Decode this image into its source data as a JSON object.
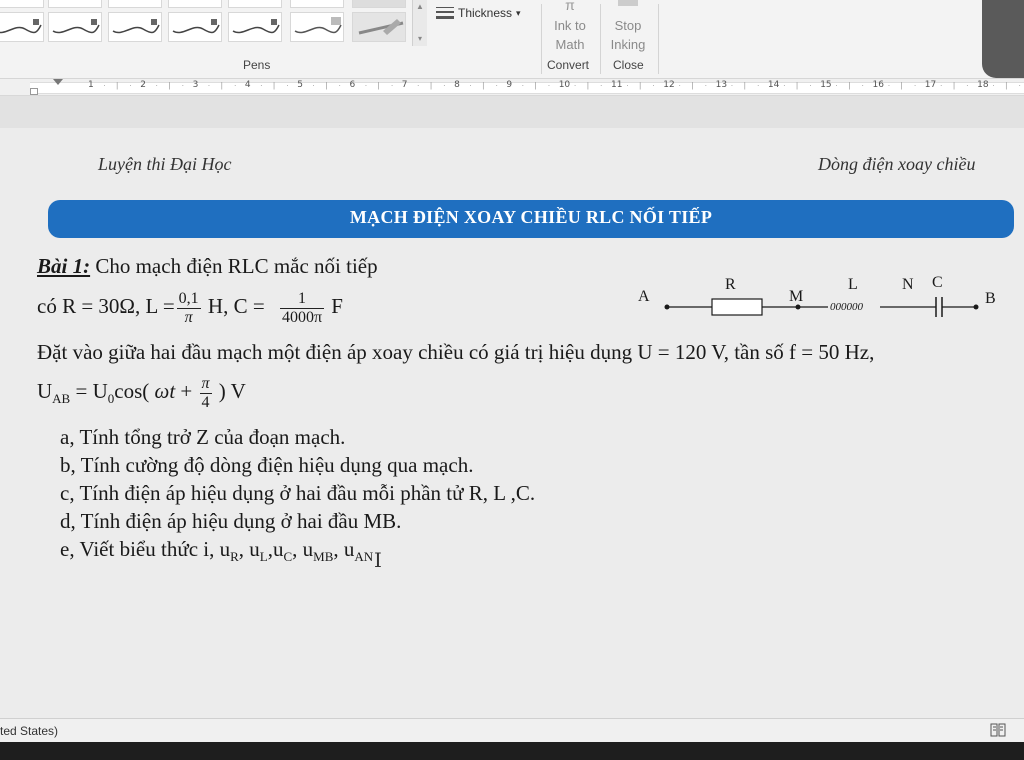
{
  "ribbon": {
    "thickness_label": "Thickness",
    "thickness_caret": "▾",
    "pens_scroll_up": "▲",
    "pens_scroll_more": "▾",
    "ink_to_math_line1": "Ink to",
    "ink_to_math_line2": "Math",
    "stop_inking_line1": "Stop",
    "stop_inking_line2": "Inking",
    "group_pens": "Pens",
    "group_convert": "Convert",
    "group_close": "Close"
  },
  "ruler": {
    "ticks": [
      "1",
      "2",
      "3",
      "4",
      "5",
      "6",
      "7",
      "8",
      "9",
      "10",
      "11",
      "12",
      "13",
      "14",
      "15",
      "16",
      "17",
      "18"
    ]
  },
  "document": {
    "header_left": "Luyện thi Đại Học",
    "header_right": "Dòng điện xoay chiều",
    "banner": "MẠCH ĐIỆN XOAY CHIỀU RLC NỐI TIẾP",
    "problem_label": "Bài 1:",
    "problem_intro": " Cho mạch điện RLC  mắc nối tiếp",
    "line2_a": "có R = 30Ω, L =",
    "line2_L_num": "0,1",
    "line2_L_den": "π",
    "line2_b": " H, C =",
    "line2_C_num": "1",
    "line2_C_den": "4000π",
    "line2_c": "  F",
    "line3": "Đặt vào giữa hai đầu mạch một điện áp xoay chiều có giá trị hiệu dụng U = 120 V, tần số f = 50 Hz,",
    "line4_a": "U",
    "line4_a_sub": "AB",
    "line4_b": " = U",
    "line4_b_sub": "0",
    "line4_c": "cos( ",
    "line4_omega": "ωt",
    "line4_plus": " + ",
    "line4_phase_num": "π",
    "line4_phase_den": "4",
    "line4_d": " ) V",
    "tasks": [
      "a, Tính tổng trở Z của đoạn mạch.",
      "b, Tính cường độ dòng điện hiệu dụng qua mạch.",
      "c, Tính điện áp hiệu dụng ở hai đầu mỗi phần tử R, L ,C.",
      "d, Tính điện áp hiệu dụng ở hai đầu MB."
    ],
    "task_e_prefix": "e, Viết biểu thức i, u",
    "task_e_parts": [
      {
        "sub": "R",
        "after": ", u"
      },
      {
        "sub": "L",
        "after": ",u"
      },
      {
        "sub": "C",
        "after": ", u"
      },
      {
        "sub": "MB",
        "after": ", u"
      },
      {
        "sub": "AN",
        "after": ""
      }
    ]
  },
  "circuit": {
    "label_A": "A",
    "label_R": "R",
    "label_M": "M",
    "label_L": "L",
    "label_N": "N",
    "label_C": "C",
    "label_B": "B",
    "coil_text": "000000"
  },
  "status": {
    "language": "ted States)"
  },
  "colors": {
    "banner": "#1f6fc0",
    "ribbon": "#f3f3f3",
    "page": "#ececec"
  },
  "icons": [
    "pen-icon",
    "thickness-icon",
    "ink-to-math-icon",
    "stop-inking-icon",
    "book-icon",
    "text-cursor-icon"
  ]
}
